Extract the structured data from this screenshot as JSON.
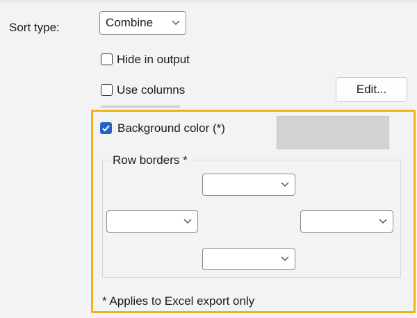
{
  "sort_type": {
    "label": "Sort type:",
    "value": "Combine"
  },
  "hide_in_output": {
    "label": "Hide in output",
    "checked": false
  },
  "use_columns": {
    "label": "Use columns",
    "checked": false
  },
  "edit_button": {
    "label": "Edit..."
  },
  "background_color": {
    "label": "Background color (*)",
    "checked": true,
    "swatch_color": "#d3d3d3"
  },
  "row_borders": {
    "title": "Row borders *",
    "top": "",
    "left": "",
    "right": "",
    "bottom": ""
  },
  "footnote": "* Applies to Excel export only",
  "colors": {
    "highlight_border": "#f2b215",
    "checkbox_checked": "#2563c8"
  }
}
